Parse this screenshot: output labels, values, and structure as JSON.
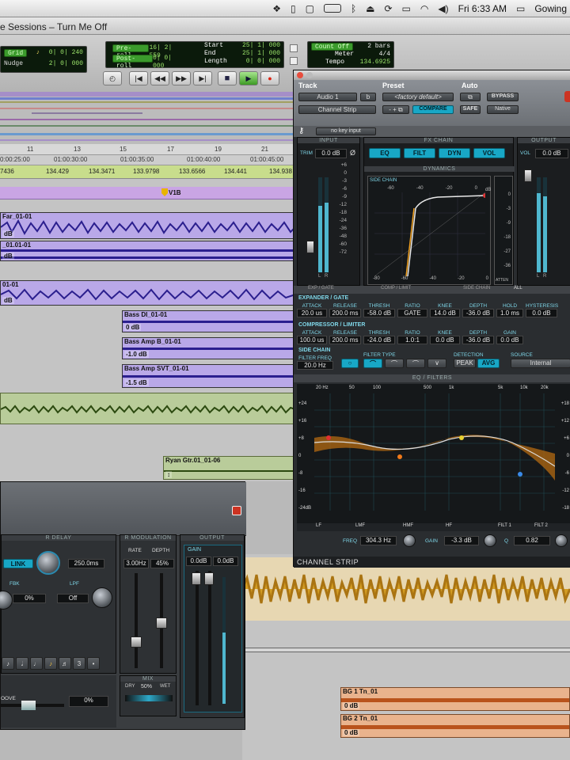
{
  "menubar": {
    "clock": "Fri 6:33 AM",
    "user": "Gowing",
    "icons": [
      "dropbox-icon",
      "tablet-icon",
      "square-icon",
      "battery-outline-icon",
      "bluetooth-icon",
      "eject-icon",
      "sync-icon",
      "display-icon",
      "wifi-icon",
      "volume-icon",
      "battery-icon"
    ]
  },
  "window": {
    "title": "e Sessions – Turn Me Off"
  },
  "toolbar": {
    "grid_label": "Grid",
    "grid_value": "0| 0| 240",
    "nudge_label": "Nudge",
    "nudge_value": "2| 0| 000",
    "preroll_label": "Pre-roll",
    "preroll_value": "16| 2| 559",
    "postroll_label": "Post-roll",
    "postroll_value": "0| 0| 000",
    "start_label": "Start",
    "start_value": "25| 1| 000",
    "end_label": "End",
    "end_value": "25| 1| 000",
    "length_label": "Length",
    "length_value": "0| 0| 000",
    "countoff_label": "Count Off",
    "countoff_value": "2 bars",
    "meter_label": "Meter",
    "meter_value": "4/4",
    "tempo_label": "Tempo",
    "tempo_value": "134.6925"
  },
  "ruler": {
    "bars": [
      "11",
      "13",
      "15",
      "17",
      "19",
      "21"
    ],
    "timecodes": [
      "0:00:25:00",
      "01:00:30:00",
      "01:00:35:00",
      "01:00:40:00",
      "01:00:45:00"
    ],
    "tempos": [
      "7436",
      "134.429",
      "134.3471",
      "133.9798",
      "133.6566",
      "134.441",
      "134.938"
    ],
    "marker_label": "V1B"
  },
  "tracks": [
    {
      "name": "Far_01-01",
      "gain": "dB"
    },
    {
      "name": "_01.01-01",
      "gain": "dB"
    },
    {
      "name": "01-01",
      "gain": "dB"
    },
    {
      "name": "Bass DI_01-01",
      "gain": "0 dB"
    },
    {
      "name": "Bass Amp B_01-01",
      "gain": "-1.0 dB"
    },
    {
      "name": "Bass Amp SVT_01-01",
      "gain": "-1.5 dB"
    },
    {
      "name": "Ryan Gtr.01_01-06",
      "gain": ""
    },
    {
      "name": "BG 1 Tn_01",
      "gain": "0 dB"
    },
    {
      "name": "BG 2 Tn_01",
      "gain": "0 dB"
    }
  ],
  "plugin": {
    "track_label": "Track",
    "preset_label": "Preset",
    "auto_label": "Auto",
    "track_name": "Audio 1",
    "track_slot": "b",
    "plugin_name": "Channel Strip",
    "preset_name": "<factory default>",
    "compare_label": "COMPARE",
    "safe_label": "SAFE",
    "bypass_label": "BYPASS",
    "native_label": "Native",
    "key_input": "no key input",
    "input_hdr": "INPUT",
    "fxchain_hdr": "FX CHAIN",
    "output_hdr": "OUTPUT",
    "trim_label": "TRIM",
    "trim_value": "0.0 dB",
    "vol_label": "VOL",
    "vol_value": "0.0 dB",
    "fx_buttons": [
      "EQ",
      "FILT",
      "DYN",
      "VOL"
    ],
    "dynamics_hdr": "DYNAMICS",
    "sidechain_graph_label": "SIDE CHAIN",
    "graph_x_ticks": [
      "-60",
      "-40",
      "-20",
      "0"
    ],
    "graph_bottom_ticks": [
      "-80",
      "-60",
      "-40",
      "-20",
      "0"
    ],
    "graph_y_ticks": [
      "0",
      "-3",
      "-6",
      "-9",
      "-12",
      "-18",
      "-24",
      "-30",
      "-36",
      "-48",
      "-60",
      "-72"
    ],
    "gr_ticks": [
      "0",
      "-3",
      "-9",
      "-18",
      "-27",
      "-36"
    ],
    "atten_label": "ATTEN",
    "db_label": "dB",
    "tabs": [
      "EXP / GATE",
      "COMP / LIMIT",
      "SIDE CHAIN",
      "ALL"
    ],
    "expander": {
      "title": "EXPANDER / GATE",
      "labels": [
        "ATTACK",
        "RELEASE",
        "THRESH",
        "RATIO",
        "KNEE",
        "DEPTH",
        "HOLD",
        "HYSTERESIS"
      ],
      "values": [
        "20.0 us",
        "200.0 ms",
        "-58.0 dB",
        "GATE",
        "14.0 dB",
        "-36.0 dB",
        "1.0 ms",
        "0.0 dB"
      ]
    },
    "compressor": {
      "title": "COMPRESSOR / LIMITER",
      "labels": [
        "ATTACK",
        "RELEASE",
        "THRESH",
        "RATIO",
        "KNEE",
        "DEPTH",
        "GAIN"
      ],
      "values": [
        "100.0 us",
        "200.0 ms",
        "-24.0 dB",
        "1.0:1",
        "0.0 dB",
        "-36.0 dB",
        "0.0 dB"
      ]
    },
    "sidechain": {
      "title": "SIDE CHAIN",
      "filter_freq_label": "FILTER FREQ",
      "filter_freq_value": "20.0 Hz",
      "filter_type_label": "FILTER TYPE",
      "detection_label": "DETECTION",
      "peak_label": "PEAK",
      "avg_label": "AVG",
      "source_label": "SOURCE",
      "source_value": "Internal"
    },
    "eq_hdr": "EQ / FILTERS",
    "eq_freqs": [
      "20 Hz",
      "50",
      "100",
      "500",
      "1k",
      "5k",
      "10k",
      "20k"
    ],
    "eq_left_db": [
      "+24",
      "+16",
      "+8",
      "0",
      "-8",
      "-16",
      "-24dB"
    ],
    "eq_right_db": [
      "+18",
      "+12",
      "+6",
      "0",
      "-6",
      "-12",
      "-18"
    ],
    "eq_bands": [
      "LF",
      "LMF",
      "HMF",
      "HF",
      "FILT 1",
      "FILT 2"
    ],
    "freq_label": "FREQ",
    "freq_value": "304.3 Hz",
    "gain_label": "GAIN",
    "gain_value": "-3.3 dB",
    "q_label": "Q",
    "q_value": "0.82",
    "footer": "CHANNEL STRIP",
    "input_meter_ticks": [
      "+6",
      "0",
      "-3",
      "-6",
      "-9",
      "-12",
      "-18",
      "-24",
      "-36",
      "-48",
      "-60",
      "-72"
    ],
    "meter_lr": [
      "L",
      "R"
    ]
  },
  "delay": {
    "rdelay_hdr": "R DELAY",
    "link_label": "LINK",
    "delay_value": "250.0ms",
    "fbk_label": "FBK",
    "fbk_value": "0%",
    "lpf_label": "LPF",
    "lpf_value": "Off",
    "rmod_hdr": "R MODULATION",
    "rate_label": "RATE",
    "rate_value": "3.00Hz",
    "depth_label": "DEPTH",
    "depth_value": "45%",
    "output_hdr": "OUTPUT",
    "gain_label": "GAIN",
    "gain_l": "0.0dB",
    "gain_r": "0.0dB",
    "mix_label": "MIX",
    "dry_label": "DRY",
    "mix_value": "50%",
    "wet_label": "WET",
    "note_buttons": [
      "♪",
      "𝅗𝅥",
      "♩",
      "♪",
      "♬",
      "3",
      "•"
    ],
    "groove_label": "OOVE",
    "groove_value": "0%"
  },
  "colors": {
    "purple_clip": "#b9a8e8",
    "tempo_bar": "#c8dd8c",
    "marker_bar": "#c9a5e4",
    "green_clip": "#b9cc9a",
    "orange_clip": "#e9b38d",
    "yellow_audio": "#d29a1c",
    "teal_accent": "#18a7c6"
  }
}
